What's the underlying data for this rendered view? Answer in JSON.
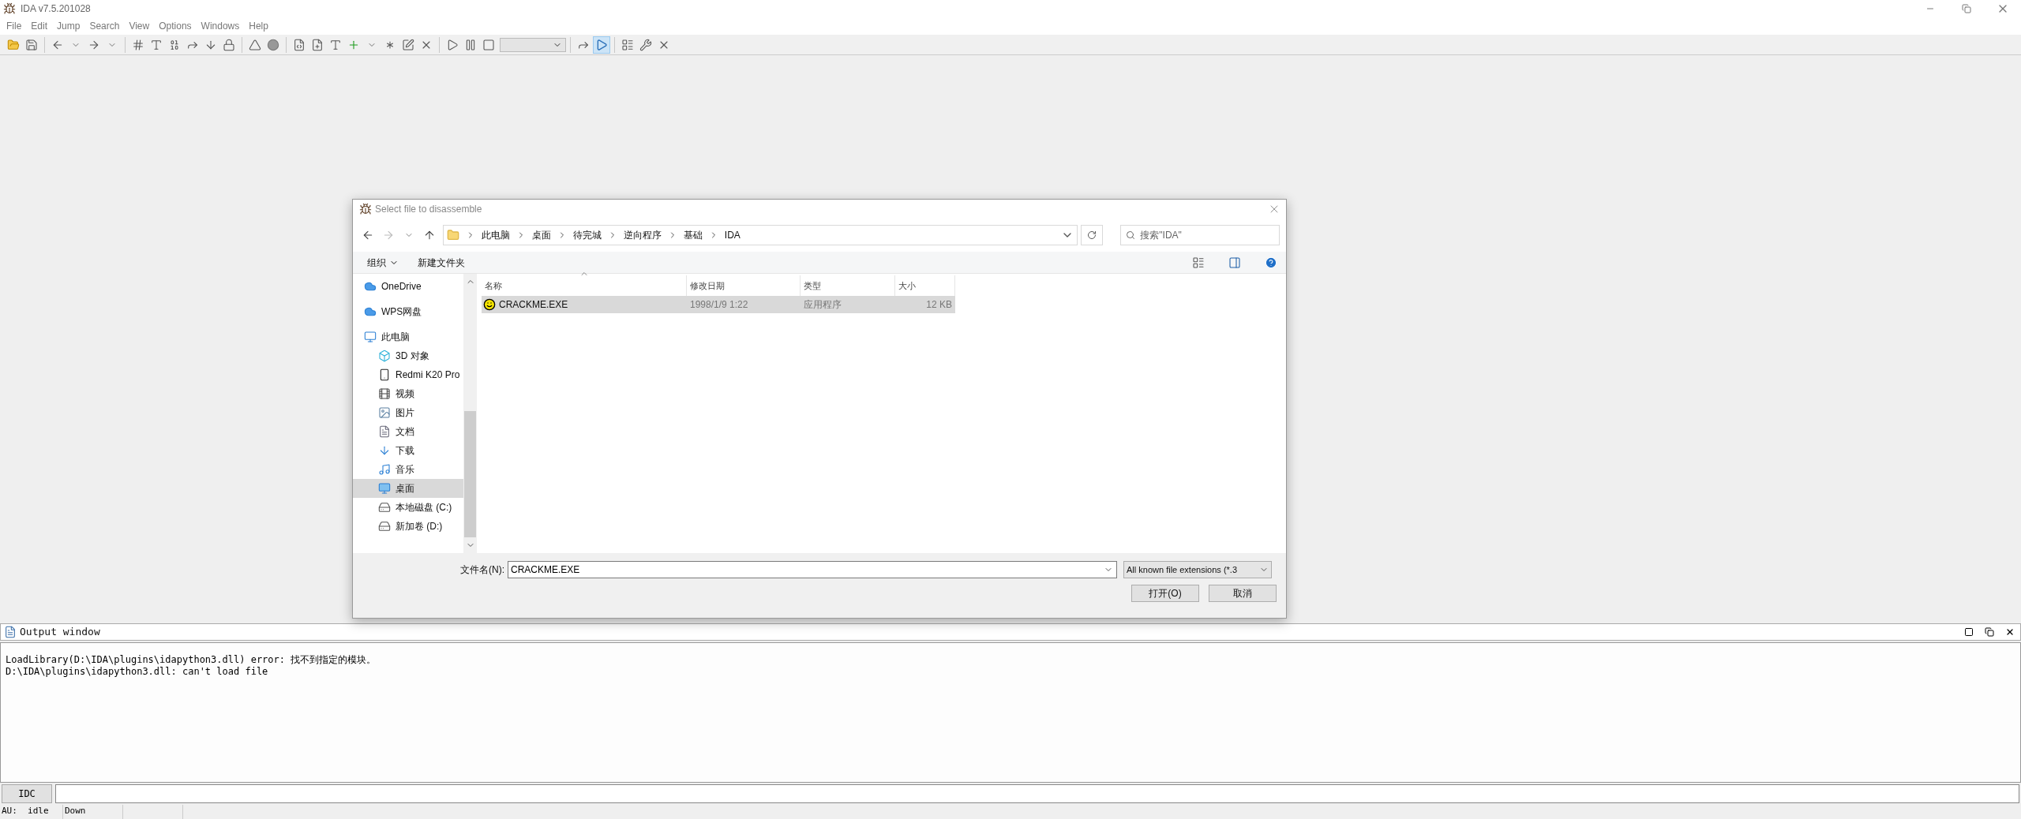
{
  "window": {
    "title": "IDA v7.5.201028"
  },
  "menu": [
    "File",
    "Edit",
    "Jump",
    "Search",
    "View",
    "Options",
    "Windows",
    "Help"
  ],
  "dialog": {
    "title": "Select file to disassemble",
    "breadcrumb": [
      "此电脑",
      "桌面",
      "待完城",
      "逆向程序",
      "基础",
      "IDA"
    ],
    "search": {
      "placeholder": "搜索\"IDA\""
    },
    "commands": [
      "组织",
      "新建文件夹"
    ],
    "nav": [
      {
        "kind": "cloud",
        "label": "OneDrive",
        "selected": false
      },
      {
        "kind": "cloud",
        "label": "WPS网盘",
        "selected": false
      },
      {
        "kind": "pc",
        "label": "此电脑",
        "selected": false,
        "children": [
          {
            "kind": "cube",
            "label": "3D 对象",
            "selected": false
          },
          {
            "kind": "phone",
            "label": "Redmi K20 Pro",
            "selected": false
          },
          {
            "kind": "video",
            "label": "视频",
            "selected": false
          },
          {
            "kind": "image",
            "label": "图片",
            "selected": false
          },
          {
            "kind": "doc",
            "label": "文档",
            "selected": false
          },
          {
            "kind": "download",
            "label": "下载",
            "selected": false
          },
          {
            "kind": "music",
            "label": "音乐",
            "selected": false
          },
          {
            "kind": "desktop",
            "label": "桌面",
            "selected": true
          },
          {
            "kind": "drive",
            "label": "本地磁盘 (C:)",
            "selected": false
          },
          {
            "kind": "drive",
            "label": "新加卷 (D:)",
            "selected": false
          }
        ]
      }
    ],
    "columns": [
      "名称",
      "修改日期",
      "类型",
      "大小"
    ],
    "rows": [
      {
        "name": "CRACKME.EXE",
        "modified": "1998/1/9 1:22",
        "type": "应用程序",
        "size": "12 KB",
        "selected": true
      }
    ],
    "filename_label": "文件名(N):",
    "filename": "CRACKME.EXE",
    "filter": "All known file extensions (*.3",
    "buttons": [
      "打开(O)",
      "取消"
    ]
  },
  "output": {
    "title": "Output window",
    "lines": [
      "LoadLibrary(D:\\IDA\\plugins\\idapython3.dll) error: 找不到指定的模块。",
      "D:\\IDA\\plugins\\idapython3.dll: can't load file"
    ],
    "idc_button": "IDC"
  },
  "status_bar": [
    "AU:  idle",
    "Down"
  ]
}
